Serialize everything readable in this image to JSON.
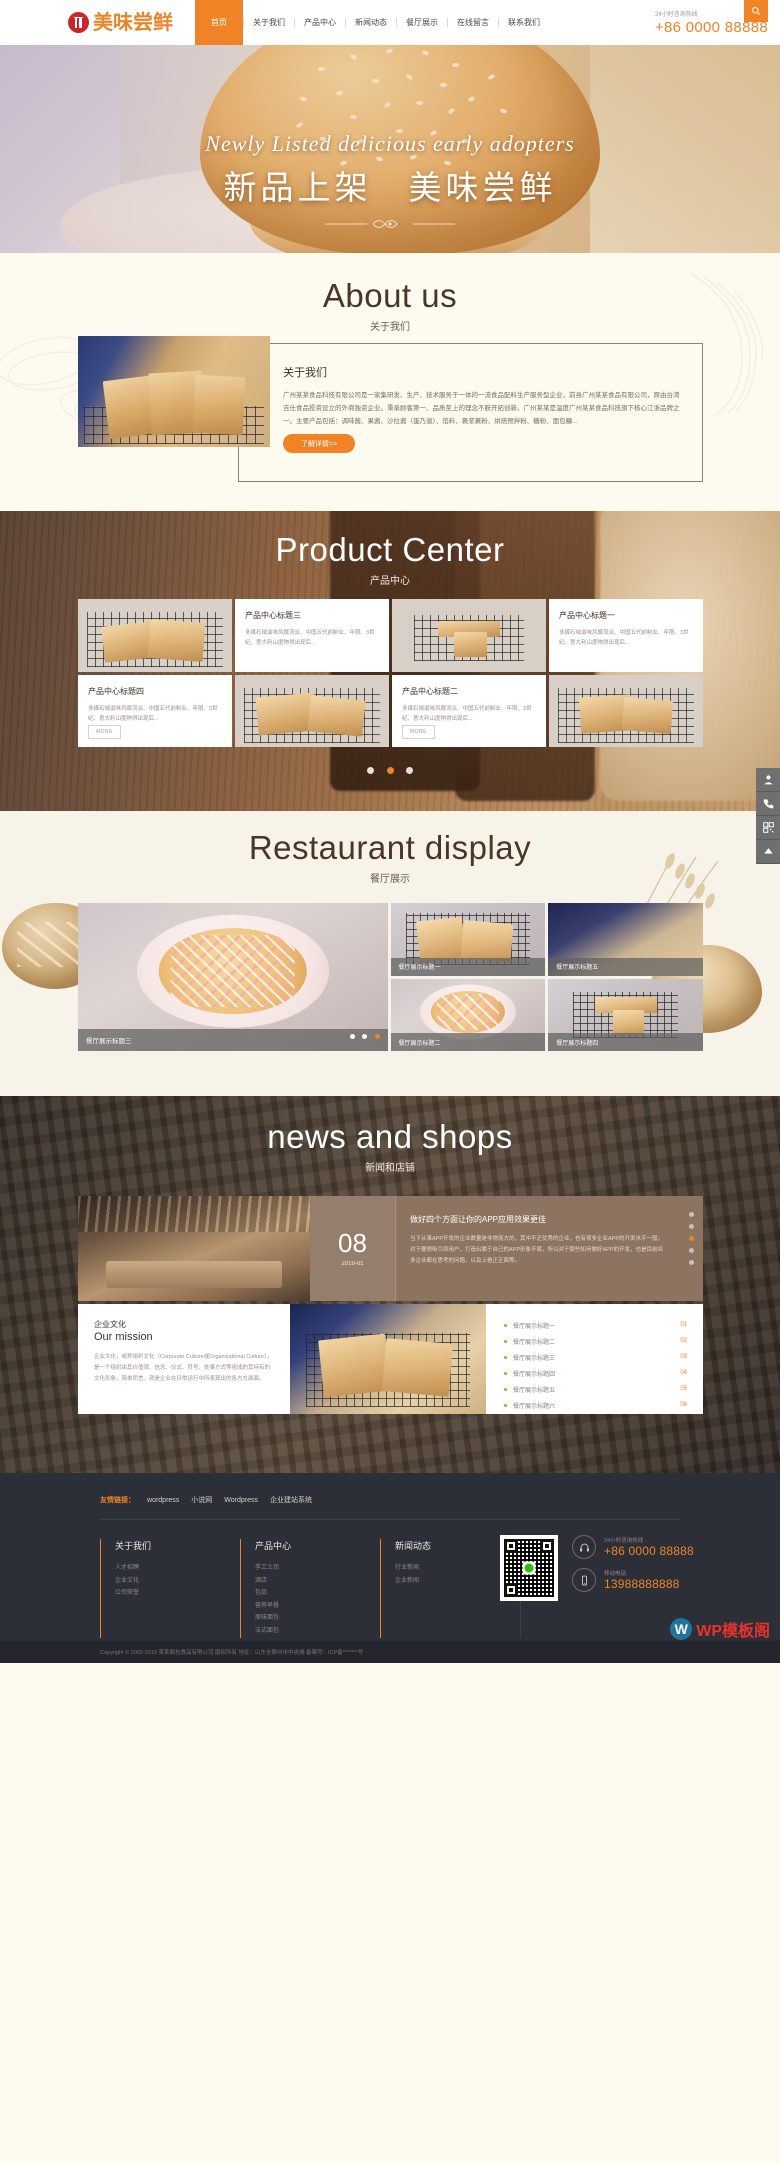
{
  "header": {
    "logo_text": "美味尝鲜",
    "nav": [
      {
        "label": "首页",
        "active": true
      },
      {
        "label": "关于我们",
        "active": false
      },
      {
        "label": "产品中心",
        "active": false
      },
      {
        "label": "新闻动态",
        "active": false
      },
      {
        "label": "餐厅展示",
        "active": false
      },
      {
        "label": "在线留言",
        "active": false
      },
      {
        "label": "联系我们",
        "active": false
      }
    ],
    "phone_label": "24小时咨询热线",
    "phone_number": "+86 0000 88888",
    "search_icon": "search-icon"
  },
  "hero": {
    "script_text": "Newly Listed delicious early adopters",
    "headline": "新品上架　美味尝鲜"
  },
  "about": {
    "title_en": "About us",
    "title_zh": "关于我们",
    "heading": "关于我们",
    "paragraph": "广州某某食品科技有限公司是一家集研发、生产、技术服务于一体的一流食品配料生产服务型企业，前身广州某某食品有限公司，原由台湾吉仕食品投资设立的外商独资企业。秉承顾客第一、品质至上的理念不断开拓创新。广州某某是温度广州某某食品科技旗下核心江浙品牌之一。主要产品包括：调味酱、果酱、沙拉酱（蛋乃滋）、馅料、裹浆裹粉、烘焙预拌粉、糖粉、面包糠...",
    "button_label": "了解详情>>"
  },
  "product": {
    "title_en": "Product Center",
    "title_zh": "产品中心",
    "cards": [
      {
        "title": "产品中心标题三",
        "desc": "多媒石域滋味风靡流派、中国五代前制业、年限、3世纪、意大利山度物得出现后...",
        "more": ""
      },
      {
        "title": "产品中心标题一",
        "desc": "多媒石域滋味风靡流派、中国五代前制业、年限、3世纪、意大利山度物得出现后...",
        "more": ""
      },
      {
        "title": "产品中心标题四",
        "desc": "多媒石域滋味风靡流派、中国五代前制业、年限、3世纪、意大利山度物得出现后...",
        "more": "MORE"
      },
      {
        "title": "产品中心标题二",
        "desc": "多媒石域滋味风靡流派、中国五代前制业、年限、3世纪、意大利山度物得出现后...",
        "more": "MORE"
      }
    ],
    "dots": 3,
    "active_dot": 2
  },
  "dock": [
    {
      "name": "user-icon"
    },
    {
      "name": "phone-icon"
    },
    {
      "name": "qrcode-icon"
    },
    {
      "name": "arrow-up-icon"
    }
  ],
  "restaurant": {
    "title_en": "Restaurant display",
    "title_zh": "餐厅展示",
    "items": [
      {
        "caption": "餐厅展示标题三"
      },
      {
        "caption": "餐厅展示标题一"
      },
      {
        "caption": "餐厅展示标题五"
      },
      {
        "caption": "餐厅展示标题二"
      },
      {
        "caption": "餐厅展示标题四"
      }
    ],
    "dots": 3,
    "active_dot": 2
  },
  "news": {
    "title_en": "news and shops",
    "title_zh": "新闻和店铺",
    "featured": {
      "day": "08",
      "ym": "2019-01",
      "title": "做好四个方面让你的APP应用效果更佳",
      "desc": "当下从事APP开发的企业数量是非常庞大的，其中不乏优秀的企业，也有很多企业APP的开发水平一般。对于要想吸引到用户，打造出属于自己的APP形象不易，所以对于那些如何做好APP的开发，也是目前众多企业都在思考的问题。以及上看正正面等。",
      "dots": 5,
      "active_dot": 2
    },
    "mission": {
      "zh": "企业文化",
      "en": "Our mission",
      "paragraph": "企业文化，或称组织文化（Corporate Culture或Organizational Culture），是一个组织由其价值观、信念、仪式、符号、处事方式等组成的其特有的文化形象，简单而言，就是企业在日常运行中所表现出的各方方面面。"
    },
    "list": [
      {
        "label": "餐厅展示标题一",
        "num": "01"
      },
      {
        "label": "餐厅展示标题二",
        "num": "02"
      },
      {
        "label": "餐厅展示标题三",
        "num": "03"
      },
      {
        "label": "餐厅展示标题四",
        "num": "04"
      },
      {
        "label": "餐厅展示标题五",
        "num": "05"
      },
      {
        "label": "餐厅展示标题六",
        "num": "06"
      }
    ]
  },
  "footer": {
    "friend_label": "友情链接：",
    "friend_links": [
      "wordpress",
      "小说网",
      "Wordpress",
      "企业建站系统"
    ],
    "columns": [
      {
        "title": "关于我们",
        "items": [
          "人才招聘",
          "企业文化",
          "公司荣誉"
        ]
      },
      {
        "title": "产品中心",
        "items": [
          "手工土司",
          "酒店",
          "包品",
          "营养早餐",
          "原味面包",
          "法式面包"
        ]
      },
      {
        "title": "新闻动态",
        "items": [
          "行业新闻",
          "企业新闻"
        ]
      }
    ],
    "qr_name": "wechat-qrcode",
    "hotline_label": "24小时咨询热线",
    "hotline_number": "+86 0000 88888",
    "mobile_label": "移动电话",
    "mobile_number": "13988888888",
    "copyright": "Copyright © 2002-2019 某某面包食品有限公司 版权所有   地址：山东全聊州市中央城   备案号：ICP备*******号",
    "badge_text": "WP模板阁"
  },
  "colors": {
    "accent": "#ef8325",
    "dark": "#2c2f38",
    "cream": "#fdfaf0"
  }
}
